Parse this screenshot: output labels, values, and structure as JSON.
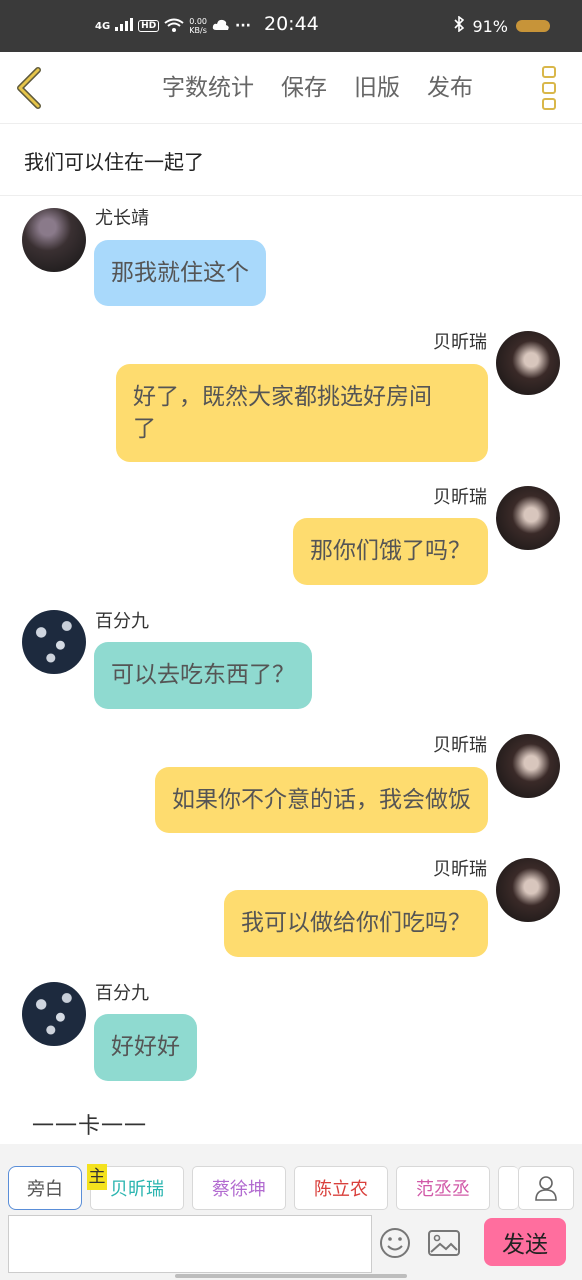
{
  "status_bar": {
    "network": "4G",
    "hd": "HD",
    "speed_value": "0.00",
    "speed_unit": "KB/s",
    "more": "···",
    "time": "20:44",
    "battery": "91%",
    "colors": {
      "background": "#3a3a3a",
      "text": "#ffffff"
    }
  },
  "header": {
    "actions": [
      "字数统计",
      "保存",
      "旧版",
      "发布"
    ],
    "accent_color": "#d9b74a"
  },
  "story_title": "我们可以住在一起了",
  "messages": [
    {
      "sender": "尤长靖",
      "text": "那我就住这个",
      "side": "left",
      "bubble_color": "#a9d9fb",
      "avatar": "male-avatar"
    },
    {
      "sender": "贝昕瑞",
      "line1": "好了，既然大家都挑选好房间",
      "line2": "了",
      "side": "right",
      "bubble_color": "#fedc6f",
      "avatar": "female-avatar"
    },
    {
      "sender": "贝昕瑞",
      "text": "那你们饿了吗？",
      "side": "right",
      "bubble_color": "#fedc6f",
      "avatar": "female-avatar"
    },
    {
      "sender": "百分九",
      "text": "可以去吃东西了？",
      "side": "left",
      "bubble_color": "#8fdad0",
      "avatar": "group-avatar"
    },
    {
      "sender": "贝昕瑞",
      "text": "如果你不介意的话，我会做饭",
      "side": "right",
      "bubble_color": "#fedc6f",
      "avatar": "female-avatar"
    },
    {
      "sender": "贝昕瑞",
      "text": "我可以做给你们吃吗？",
      "side": "right",
      "bubble_color": "#fedc6f",
      "avatar": "female-avatar"
    },
    {
      "sender": "百分九",
      "text": "好好好",
      "side": "left",
      "bubble_color": "#8fdad0",
      "avatar": "group-avatar"
    }
  ],
  "narration": "一一卡一一",
  "characters": {
    "main_badge": "主",
    "chips": [
      {
        "label": "旁白",
        "color": "#555555"
      },
      {
        "label": "贝昕瑞",
        "color": "#2bb5b0"
      },
      {
        "label": "蔡徐坤",
        "color": "#b26bd0"
      },
      {
        "label": "陈立农",
        "color": "#d9403c"
      },
      {
        "label": "范丞丞",
        "color": "#d15aa8"
      }
    ]
  },
  "composer": {
    "input_value": "",
    "send_label": "发送",
    "send_color": "#ff6e9e"
  }
}
